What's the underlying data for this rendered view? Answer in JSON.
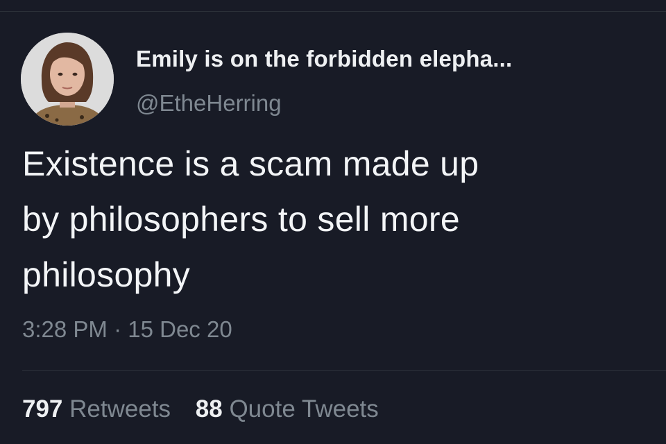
{
  "tweet": {
    "author": {
      "display_name": "Emily is on the forbidden elepha...",
      "handle": "@EtheHerring",
      "avatar_icon": "profile-photo"
    },
    "text_lines": [
      "Existence is a scam made up",
      "by philosophers to sell more",
      "philosophy"
    ],
    "time": "3:28 PM",
    "separator": "·",
    "date": "15 Dec 20",
    "stats": {
      "retweets_count": "797",
      "retweets_label": "Retweets",
      "quotes_count": "88",
      "quotes_label": "Quote Tweets"
    }
  },
  "colors": {
    "background": "#181b26",
    "primary_text": "#f3f5f7",
    "secondary_text": "#7f8891",
    "divider": "#2e333c"
  }
}
